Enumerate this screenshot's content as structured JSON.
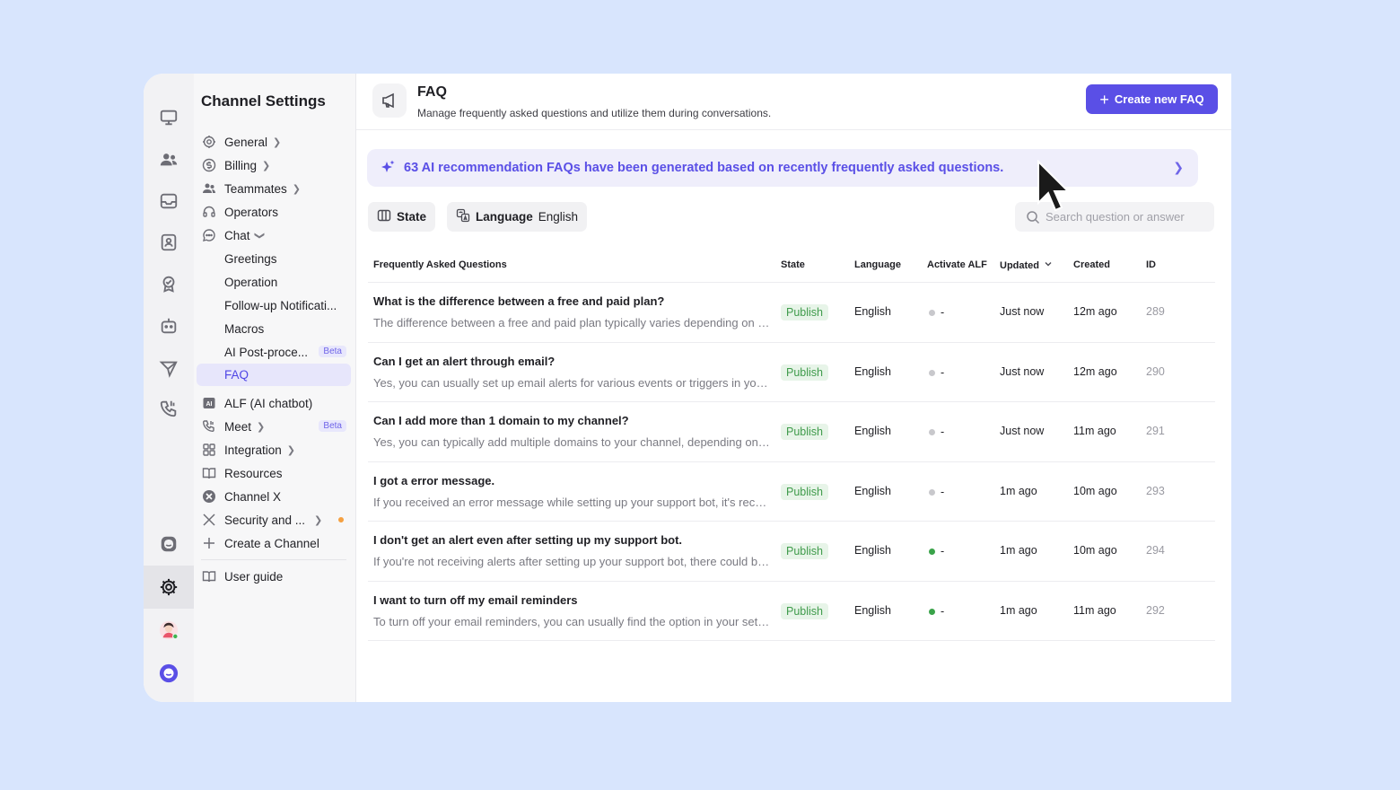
{
  "sidebar": {
    "title": "Channel Settings",
    "items": [
      {
        "label": "General"
      },
      {
        "label": "Billing"
      },
      {
        "label": "Teammates"
      },
      {
        "label": "Operators"
      },
      {
        "label": "Chat"
      },
      {
        "label": "Greetings"
      },
      {
        "label": "Operation"
      },
      {
        "label": "Follow-up Notificati..."
      },
      {
        "label": "Macros"
      },
      {
        "label": "AI Post-proce...",
        "badge": "Beta"
      },
      {
        "label": "FAQ"
      },
      {
        "label": "ALF (AI chatbot)"
      },
      {
        "label": "Meet",
        "badge": "Beta"
      },
      {
        "label": "Integration"
      },
      {
        "label": "Resources"
      },
      {
        "label": "Channel X"
      },
      {
        "label": "Security and ..."
      },
      {
        "label": "Create a Channel"
      },
      {
        "label": "User guide"
      }
    ]
  },
  "header": {
    "title": "FAQ",
    "subtitle": "Manage frequently asked questions and utilize them during conversations.",
    "create_label": "Create new FAQ"
  },
  "banner": {
    "text": "63 AI recommendation FAQs have been generated based on recently frequently asked questions."
  },
  "filters": {
    "state_label": "State",
    "language_label": "Language",
    "language_value": "English"
  },
  "search": {
    "placeholder": "Search question or answer"
  },
  "table": {
    "headers": [
      "Frequently Asked Questions",
      "State",
      "Language",
      "Activate ALF",
      "Updated",
      "Created",
      "ID"
    ],
    "rows": [
      {
        "question": "What is the difference between a free and paid plan?",
        "answer": "The difference between a free and paid plan typically varies depending on the service",
        "state": "Publish",
        "language": "English",
        "alf": "-",
        "alf_active": false,
        "updated": "Just now",
        "created": "12m ago",
        "id": "289"
      },
      {
        "question": "Can I get an alert through email?",
        "answer": "Yes, you can usually set up email alerts for various events or triggers in your account",
        "state": "Publish",
        "language": "English",
        "alf": "-",
        "alf_active": false,
        "updated": "Just now",
        "created": "12m ago",
        "id": "290"
      },
      {
        "question": "Can I add more than 1 domain to my channel?",
        "answer": "Yes, you can typically add multiple domains to your channel, depending on your plan",
        "state": "Publish",
        "language": "English",
        "alf": "-",
        "alf_active": false,
        "updated": "Just now",
        "created": "11m ago",
        "id": "291"
      },
      {
        "question": "I got a error message.",
        "answer": "If you received an error message while setting up your support bot, it's recommended",
        "state": "Publish",
        "language": "English",
        "alf": "-",
        "alf_active": false,
        "updated": "1m ago",
        "created": "10m ago",
        "id": "293"
      },
      {
        "question": "I don't get an alert even after setting up my support bot.",
        "answer": "If you're not receiving alerts after setting up your support bot, there could be several",
        "state": "Publish",
        "language": "English",
        "alf": "-",
        "alf_active": true,
        "updated": "1m ago",
        "created": "10m ago",
        "id": "294"
      },
      {
        "question": "I want to turn off my email reminders",
        "answer": "To turn off your email reminders, you can usually find the option in your settings",
        "state": "Publish",
        "language": "English",
        "alf": "-",
        "alf_active": true,
        "updated": "1m ago",
        "created": "11m ago",
        "id": "292"
      }
    ]
  },
  "colors": {
    "accent": "#5a4fe6",
    "publish_bg": "#e7f4e8",
    "publish_text": "#3f9b4b",
    "alf_on": "#3aa34a",
    "alf_off": "#c8c8cc"
  },
  "rail_icons": [
    "desktop-icon",
    "team-icon",
    "inbox-icon",
    "contacts-icon",
    "badge-icon",
    "bot-icon",
    "send-icon",
    "phone-icon",
    "chat-bubble-icon",
    "settings-icon",
    "avatar",
    "channel-logo-icon"
  ]
}
